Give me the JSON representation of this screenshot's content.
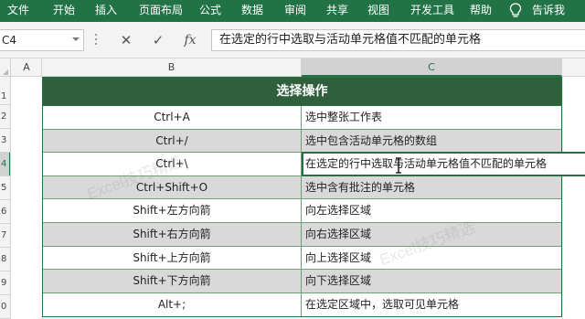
{
  "ribbon": {
    "tabs": [
      "文件",
      "开始",
      "插入",
      "页面布局",
      "公式",
      "数据",
      "审阅",
      "共享",
      "视图",
      "开发工具",
      "帮助"
    ],
    "tell_me": "告诉我",
    "bg_color": "#217346"
  },
  "formula_bar": {
    "name_box": "C4",
    "cancel_icon": "✕",
    "enter_icon": "✓",
    "fx_icon": "fx",
    "formula": "在选定的行中选取与活动单元格值不匹配的单元格"
  },
  "columns": [
    "A",
    "B",
    "C"
  ],
  "rows": [
    "1",
    "2",
    "3",
    "4",
    "5",
    "6",
    "7",
    "8",
    "9",
    "0"
  ],
  "table": {
    "header": "选择操作",
    "header_color": "#305f3c",
    "rows": [
      {
        "key": "Ctrl+A",
        "value": "选中整张工作表"
      },
      {
        "key": "Ctrl+/",
        "value": "选中包含活动单元格的数组"
      },
      {
        "key": "Ctrl+\\",
        "value": "在选定的行中选取与活动单元格值不匹配的单元格"
      },
      {
        "key": "Ctrl+Shift+O",
        "value": "选中含有批注的单元格"
      },
      {
        "key": "Shift+左方向箭",
        "value": "向左选择区域"
      },
      {
        "key": "Shift+右方向箭",
        "value": "向右选择区域"
      },
      {
        "key": "Shift+上方向箭",
        "value": "向上选择区域"
      },
      {
        "key": "Shift+下方向箭",
        "value": "向下选择区域"
      },
      {
        "key": "Alt+;",
        "value": "在选定区域中，选取可见单元格"
      }
    ]
  },
  "watermark": "Excel技巧精选"
}
